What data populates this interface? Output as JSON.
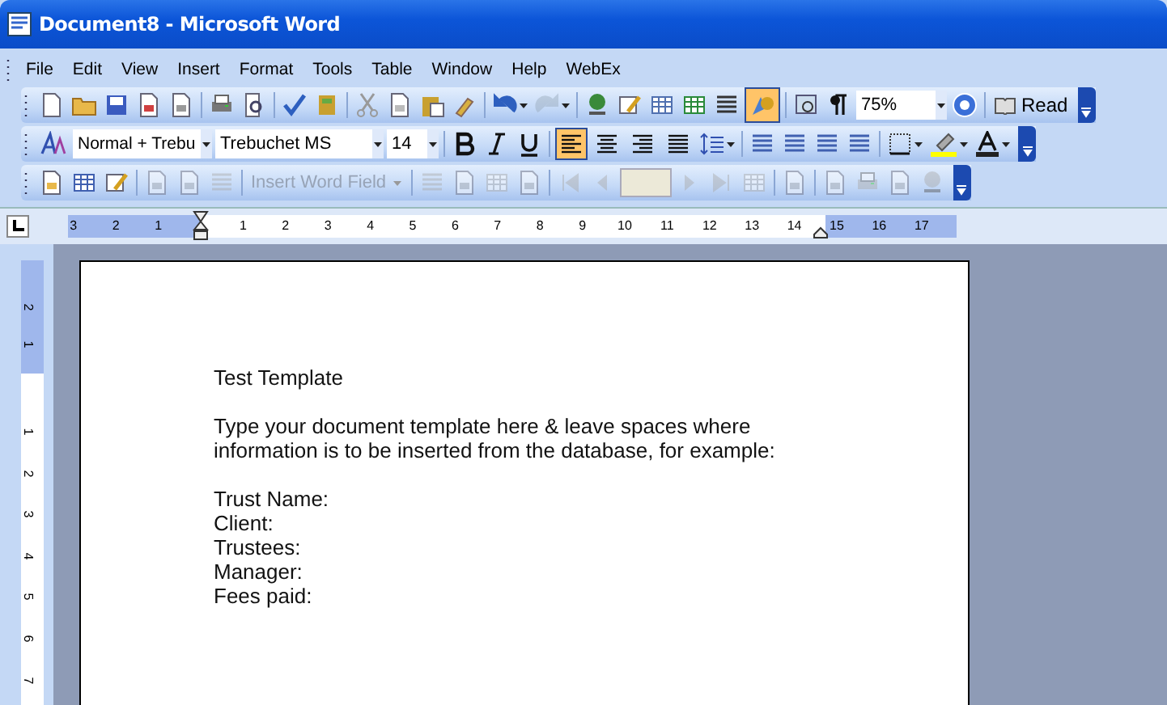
{
  "window": {
    "title": "Document8 - Microsoft Word"
  },
  "menu": [
    "File",
    "Edit",
    "View",
    "Insert",
    "Format",
    "Tools",
    "Table",
    "Window",
    "Help",
    "WebEx"
  ],
  "standard_toolbar": {
    "drawing_pressed": true,
    "zoom": "75%",
    "read_label": "Read"
  },
  "formatting_toolbar": {
    "style": "Normal + Trebu",
    "font": "Trebuchet MS",
    "size": "14",
    "alignment": [
      {
        "selected": true
      },
      {
        "selected": false
      },
      {
        "selected": false
      },
      {
        "selected": false
      }
    ]
  },
  "mail_merge_toolbar": {
    "insert_word_field": "Insert Word Field",
    "disabled": true
  },
  "horizontal_ruler": {
    "left_labels": [
      "3",
      "2",
      "1"
    ],
    "labels": [
      "1",
      "2",
      "3",
      "4",
      "5",
      "6",
      "7",
      "8",
      "9",
      "10",
      "11",
      "12",
      "13",
      "14",
      "15",
      "16",
      "17"
    ]
  },
  "vertical_ruler": {
    "top_labels": [
      "2",
      "1"
    ],
    "labels": [
      "1",
      "2",
      "3",
      "4",
      "5",
      "6",
      "7"
    ]
  },
  "document": {
    "paragraphs": [
      {
        "lines": [
          "Test Template"
        ]
      },
      {
        "lines": [
          "Type your document template here & leave spaces where",
          "information is to be inserted from the database, for example:"
        ]
      },
      {
        "lines": [
          "Trust Name:",
          "Client:",
          "Trustees:",
          "Manager:",
          "Fees paid:"
        ]
      }
    ]
  }
}
